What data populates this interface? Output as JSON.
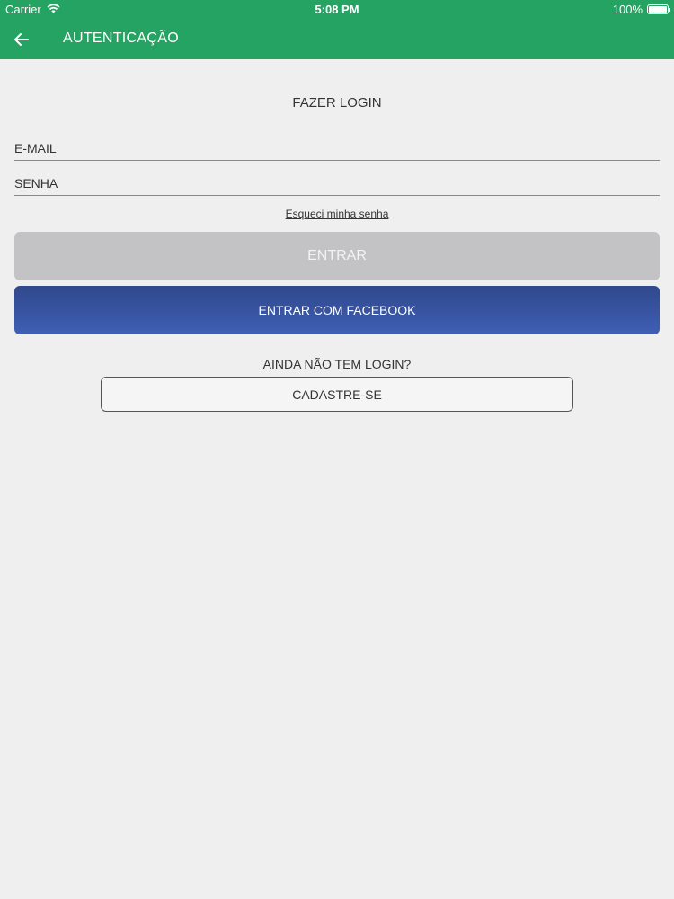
{
  "status_bar": {
    "carrier": "Carrier",
    "time": "5:08 PM",
    "battery": "100%",
    "battery_level": 1.0,
    "icons": [
      "wifi-icon",
      "battery-icon"
    ]
  },
  "header": {
    "title": "AUTENTICAÇÃO",
    "back_icon": "back-arrow-icon",
    "background_color": "#25a363"
  },
  "login": {
    "title": "FAZER LOGIN",
    "email_placeholder": "E-MAIL",
    "email_value": "",
    "password_placeholder": "SENHA",
    "password_value": "",
    "forgot_password": "Esqueci minha senha",
    "enter_button": "ENTRAR",
    "facebook_button": "ENTRAR COM FACEBOOK"
  },
  "signup": {
    "prompt": "AINDA NÃO TEM LOGIN?",
    "button": "CADASTRE-SE"
  },
  "colors": {
    "accent": "#25a363",
    "facebook": "#3a55a5",
    "disabled_button": "#c3c3c5",
    "background": "#efefef"
  }
}
